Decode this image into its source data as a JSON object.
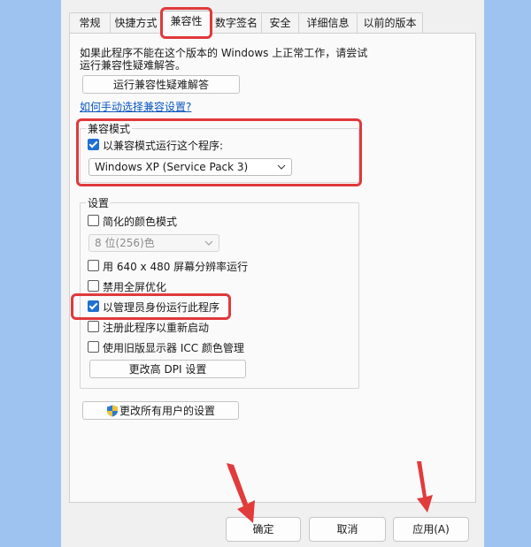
{
  "tabs": [
    "常规",
    "快捷方式",
    "兼容性",
    "数字签名",
    "安全",
    "详细信息",
    "以前的版本"
  ],
  "troubleshoot": {
    "description_line1": "如果此程序不能在这个版本的 Windows 上正常工作，请尝试",
    "description_line2": "运行兼容性疑难解答。",
    "button_label": "运行兼容性疑难解答",
    "link_label": "如何手动选择兼容设置?"
  },
  "compat_mode": {
    "group_title": "兼容模式",
    "checkbox_label": "以兼容模式运行这个程序:",
    "checked": true,
    "selected_os": "Windows XP (Service Pack 3)"
  },
  "settings": {
    "group_title": "设置",
    "reduced_color_label": "简化的颜色模式",
    "reduced_color_checked": false,
    "color_depth_value": "8 位(256)色",
    "res640_label": "用 640 x 480 屏幕分辨率运行",
    "res640_checked": false,
    "fullscreen_opt_label": "禁用全屏优化",
    "fullscreen_opt_checked": false,
    "run_as_admin_label": "以管理员身份运行此程序",
    "run_as_admin_checked": true,
    "register_restart_label": "注册此程序以重新启动",
    "register_restart_checked": false,
    "legacy_icc_label": "使用旧版显示器 ICC 颜色管理",
    "legacy_icc_checked": false,
    "dpi_button_label": "更改高 DPI 设置"
  },
  "all_users_button_label": "更改所有用户的设置",
  "footer": {
    "ok_label": "确定",
    "cancel_label": "取消",
    "apply_label": "应用(A)"
  },
  "colors": {
    "highlight": "#e0393b",
    "accent": "#1f6fd1",
    "background": "#9ec3f0"
  }
}
